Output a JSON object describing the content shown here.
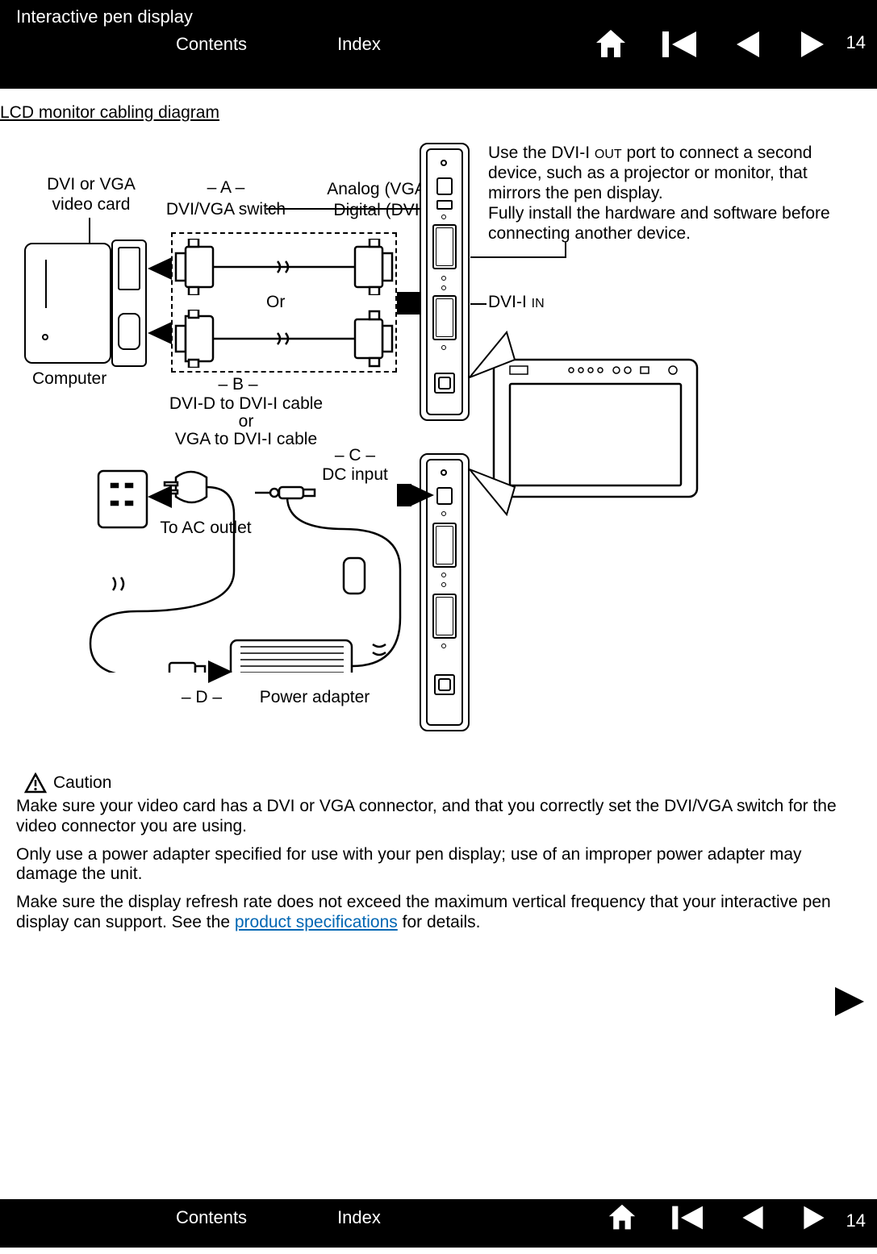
{
  "header": {
    "title": "Interactive pen display",
    "contents": "Contents",
    "index": "Index",
    "page": "14"
  },
  "section": {
    "title": "LCD monitor cabling diagram"
  },
  "diagram": {
    "dvi_vga_card": "DVI or VGA\nvideo card",
    "step_a": "– A –",
    "dvi_vga_switch": "DVI/VGA switch",
    "analog_vga": "Analog (VGA)",
    "digital_dvi": "Digital (DVI)",
    "or_label": "Or",
    "computer": "Computer",
    "step_b": "– B –",
    "cable_b_line1": "DVI-D to DVI-I cable",
    "cable_b_line2": "or",
    "cable_b_line3": "VGA to DVI-I cable",
    "step_c": "– C –",
    "dc_input": "DC input",
    "to_ac": "To AC outlet",
    "step_d": "– D –",
    "power_adapter": "Power adapter",
    "dvi_i_in": "DVI-I IN",
    "note_line1": "Use the DVI-I OUT port to connect a second device, such as a projector or monitor, that mirrors the pen display.",
    "note_line2": "Fully install the hardware and software before connecting another device."
  },
  "caution": {
    "label": "Caution",
    "p1": "Make sure your video card has a DVI or VGA connector, and that you correctly set the DVI/VGA switch for the video connector you are using.",
    "p2": "Only use a power adapter specified for use with your pen display; use of an improper power adapter may damage the unit.",
    "p3_a": "Make sure the display refresh rate does not exceed the maximum vertical frequency that your interactive pen display can support.  See the ",
    "p3_link": "product specifications",
    "p3_b": " for details."
  },
  "footer": {
    "contents": "Contents",
    "index": "Index",
    "page": "14"
  }
}
